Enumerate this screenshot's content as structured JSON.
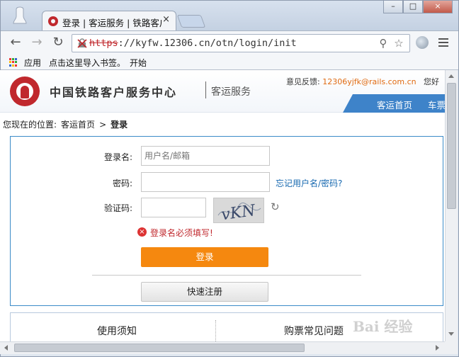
{
  "browser": {
    "tab_title": "登录 | 客运服务 | 铁路客户服务中心",
    "tab_close": "×",
    "url_scheme": "https",
    "url_rest": "://kyfw.12306.cn/otn/login/init",
    "window_buttons": [
      "–",
      "□",
      "×"
    ]
  },
  "bookmarks": {
    "apps_label": "应用",
    "import_label": "点击这里导入书签。",
    "start_label": "开始"
  },
  "header": {
    "site_name": "中国铁路客户服务中心",
    "site_sub": "客运服务",
    "feedback_label": "意见反馈:",
    "feedback_email": "12306yjfk@rails.com.cn",
    "greeting": "您好",
    "nav": [
      "客运首页",
      "车票"
    ]
  },
  "breadcrumb": {
    "prefix": "您现在的位置:",
    "home": "客运首页",
    "separator": ">",
    "current": "登录"
  },
  "login_form": {
    "username_label": "登录名:",
    "username_placeholder": "用户名/邮箱",
    "password_label": "密码:",
    "forgot_link": "忘记用户名/密码?",
    "captcha_label": "验证码:",
    "captcha_text": "vKN",
    "error_message": "登录名必须填写!",
    "login_button": "登录",
    "register_button": "快速注册"
  },
  "info_links": {
    "notice": "使用须知",
    "faq": "购票常见问题"
  },
  "watermark": "Bai 经验",
  "colors": {
    "brand_red": "#c0282d",
    "nav_blue": "#3e83c9",
    "login_orange": "#f5880f",
    "link_blue": "#1769b0",
    "email_orange": "#e06b12"
  }
}
